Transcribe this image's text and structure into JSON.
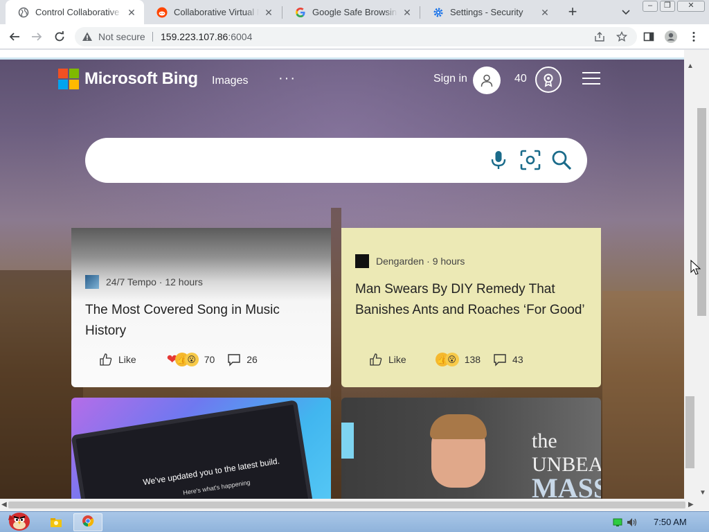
{
  "browser": {
    "tabs": [
      {
        "title": "Control Collaborative Virtual M",
        "active": true
      },
      {
        "title": "Collaborative Virtual Machine",
        "active": false
      },
      {
        "title": "Google Safe Browsing",
        "active": false
      },
      {
        "title": "Settings - Security",
        "active": false
      }
    ],
    "close_glyph": "✕",
    "new_tab_glyph": "+",
    "window_controls": {
      "minimize": "–",
      "restore": "❐",
      "close": "✕"
    },
    "address": {
      "security_label": "Not secure",
      "host": "159.223.107.86",
      "port": ":6004"
    }
  },
  "bing": {
    "logo_text": "Microsoft Bing",
    "logo_colors": [
      "#f25022",
      "#7fba00",
      "#00a4ef",
      "#ffb900"
    ],
    "nav_images": "Images",
    "nav_more": "···",
    "sign_in": "Sign in",
    "points": "40",
    "search_placeholder": ""
  },
  "feed": {
    "cards": [
      {
        "source": "24/7 Tempo · 12 hours",
        "title": "The Most Covered Song in Music History",
        "like_label": "Like",
        "reaction_count": "70",
        "comment_count": "26"
      },
      {
        "source": "Dengarden · 9 hours",
        "title": "Man Swears By DIY Remedy That Banishes Ants and Roaches ‘For Good’",
        "like_label": "Like",
        "reaction_count": "138",
        "comment_count": "43"
      }
    ],
    "image_cards": [
      {
        "headline": "We've updated you to the latest build.",
        "sub": "Here's what's happening"
      },
      {
        "poster_line1": "the UNBEA",
        "poster_line2": "MASS"
      }
    ]
  },
  "taskbar": {
    "clock": "7:50 AM"
  }
}
